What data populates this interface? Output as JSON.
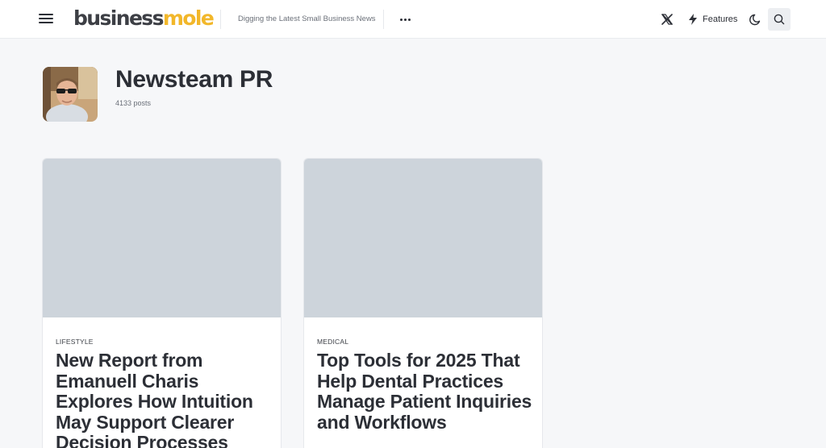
{
  "header": {
    "logo": {
      "part1": "business",
      "part2": "mole"
    },
    "tagline": "Digging the Latest Small Business News",
    "features_label": "Features",
    "icons": {
      "menu": "hamburger-menu-icon",
      "more": "more-dots-icon",
      "social": "x-icon",
      "features": "lightning-bolt-icon",
      "theme": "moon-icon",
      "search": "search-icon"
    }
  },
  "author": {
    "name": "Newsteam PR",
    "post_count": "4133 posts"
  },
  "cards": [
    {
      "category": "LIFESTYLE",
      "title": "New Report from Emanuell Charis Explores How Intuition May Support Clearer Decision Processes"
    },
    {
      "category": "MEDICAL",
      "title": "Top Tools for 2025 That Help Dental Practices Manage Patient Inquiries and Workflows"
    }
  ],
  "colors": {
    "brand_dark": "#3d3f45",
    "brand_accent": "#f2b72a",
    "background": "#f6f7f9",
    "thumb_placeholder": "#cdd4db"
  }
}
